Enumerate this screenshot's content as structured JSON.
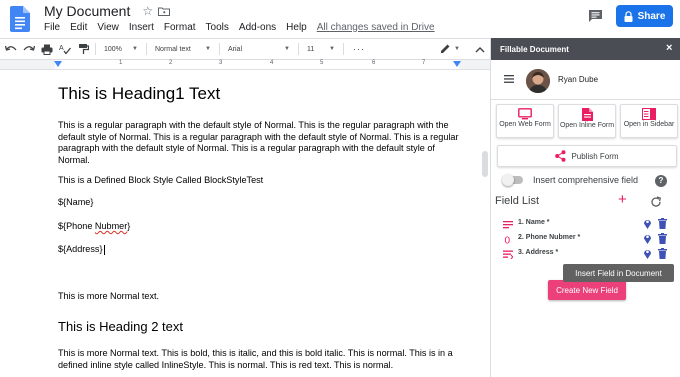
{
  "header": {
    "doc_title": "My Document",
    "menu": [
      "File",
      "Edit",
      "View",
      "Insert",
      "Format",
      "Tools",
      "Add-ons",
      "Help"
    ],
    "save_status": "All changes saved in Drive",
    "share_label": "Share"
  },
  "toolbar": {
    "zoom": "100%",
    "style": "Normal text",
    "font": "Arial",
    "size": "11",
    "more": "···"
  },
  "ruler": {
    "numbers": [
      "1",
      "2",
      "3",
      "4",
      "5",
      "6",
      "7"
    ]
  },
  "document": {
    "heading1": "This is Heading1 Text",
    "para1": "This is a regular paragraph with the default style of Normal. This is the regular paragraph with the default style of Normal. This is a regular paragraph with the default style of Normal. This is a regular paragraph with the default style of Normal. This is a regular paragraph with the default style of Normal.",
    "block_style": "This is a Defined Block Style Called BlockStyleTest",
    "field_name": "${Name}",
    "field_phone_prefix": "${Phone ",
    "field_phone_misspelled": "Nubmer",
    "field_phone_suffix": "}",
    "field_address": "${Address}",
    "normal_text": "This is more Normal text.",
    "heading2": "This is Heading 2 text",
    "para2": "This is more Normal text. This is bold, this is italic, and this is bold italic. This is normal. This is in a defined inline style called InlineStyle. This is normal. This is red text. This is normal."
  },
  "sidebar": {
    "title": "Fillable Document",
    "close": "×",
    "user_name": "Ryan Dube",
    "options": [
      {
        "label": "Open Web Form"
      },
      {
        "label": "Open Inline Form"
      },
      {
        "label": "Open in Sidebar"
      }
    ],
    "publish_label": "Publish Form",
    "toggle_label": "Insert comprehensive field",
    "toggle_on": false,
    "help": "?",
    "field_list_title": "Field List",
    "add_symbol": "+",
    "fields": [
      {
        "label": "1. Name *",
        "type": "text"
      },
      {
        "label": "2. Phone Nubmer *",
        "type": "number"
      },
      {
        "label": "3. Address *",
        "type": "multiline"
      }
    ],
    "tooltip": "Insert Field in Document",
    "create_label": "Create New Field"
  },
  "colors": {
    "accent_blue": "#1a73e8",
    "pink": "#e91e63",
    "sidebar_header": "#4a4e54",
    "create_button": "#ec407a",
    "field_action_icons": "#3f51b5"
  }
}
